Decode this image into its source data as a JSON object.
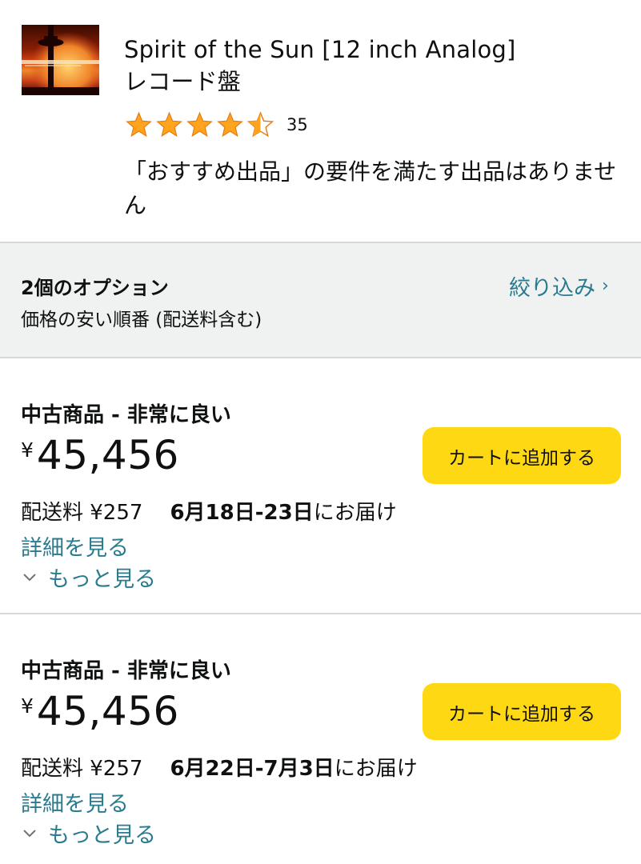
{
  "product": {
    "title": "Spirit of the Sun [12 inch Analog]",
    "format": "レコード盤",
    "rating_value": 4.5,
    "rating_count": "35",
    "notice": "「おすすめ出品」の要件を満たす出品はありません"
  },
  "options": {
    "count_label": "2個のオプション",
    "sort_label": "価格の安い順番 (配送料含む)",
    "filter_label": "絞り込み",
    "filter_chevron": "›"
  },
  "offers": [
    {
      "condition": "中古商品 - 非常に良い",
      "currency": "¥",
      "price": "45,456",
      "cart_label": "カートに追加する",
      "shipping": "配送料 ¥257",
      "delivery_date": "6月18日-23日",
      "delivery_suffix": "にお届け",
      "details_label": "詳細を見る",
      "more_label": "もっと見る"
    },
    {
      "condition": "中古商品 - 非常に良い",
      "currency": "¥",
      "price": "45,456",
      "cart_label": "カートに追加する",
      "shipping": "配送料 ¥257",
      "delivery_date": "6月22日-7月3日",
      "delivery_suffix": "にお届け",
      "details_label": "詳細を見る",
      "more_label": "もっと見る"
    }
  ],
  "icons": {
    "star": "star-icon",
    "chevron_down": "chevron-down-icon",
    "chevron_right": "chevron-right-icon"
  },
  "colors": {
    "link": "#2a7b8f",
    "star": "#ffa41c",
    "cart_button": "#ffd814",
    "options_bg": "#f0f2f2",
    "divider": "#d5d9d9",
    "text": "#0f1111"
  }
}
